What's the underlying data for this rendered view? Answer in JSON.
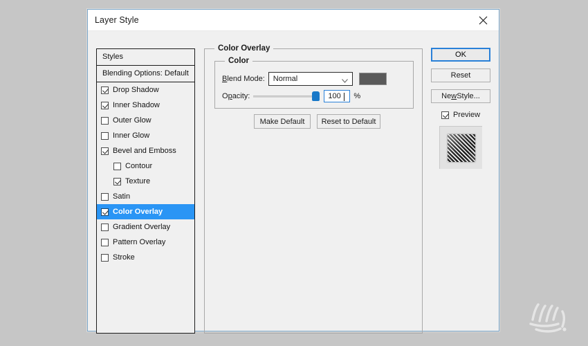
{
  "window": {
    "title": "Layer Style",
    "close_icon": "close-icon"
  },
  "styles_panel": {
    "header": "Styles",
    "blending_options": "Blending Options: Default",
    "items": [
      {
        "label": "Drop Shadow",
        "checked": true,
        "indent": false,
        "selected": false
      },
      {
        "label": "Inner Shadow",
        "checked": true,
        "indent": false,
        "selected": false
      },
      {
        "label": "Outer Glow",
        "checked": false,
        "indent": false,
        "selected": false
      },
      {
        "label": "Inner Glow",
        "checked": false,
        "indent": false,
        "selected": false
      },
      {
        "label": "Bevel and Emboss",
        "checked": true,
        "indent": false,
        "selected": false
      },
      {
        "label": "Contour",
        "checked": false,
        "indent": true,
        "selected": false
      },
      {
        "label": "Texture",
        "checked": true,
        "indent": true,
        "selected": false
      },
      {
        "label": "Satin",
        "checked": false,
        "indent": false,
        "selected": false
      },
      {
        "label": "Color Overlay",
        "checked": true,
        "indent": false,
        "selected": true
      },
      {
        "label": "Gradient Overlay",
        "checked": false,
        "indent": false,
        "selected": false
      },
      {
        "label": "Pattern Overlay",
        "checked": false,
        "indent": false,
        "selected": false
      },
      {
        "label": "Stroke",
        "checked": false,
        "indent": false,
        "selected": false
      }
    ]
  },
  "content": {
    "group_title": "Color Overlay",
    "subgroup_title": "Color",
    "blend_mode": {
      "label": "Blend Mode:",
      "label_accel": "B",
      "label_rest": "lend Mode:",
      "value": "Normal",
      "arrow_icon": "chevron-down-icon",
      "swatch_color": "#5a5a5a"
    },
    "opacity": {
      "label": "Opacity:",
      "label_pre": "O",
      "label_accel": "p",
      "label_post": "acity:",
      "value": "100",
      "unit": "%",
      "slider_percent": 100,
      "thumb_color": "#1878c8"
    },
    "make_default": "Make Default",
    "reset_to_default": "Reset to Default"
  },
  "right_panel": {
    "ok": "OK",
    "reset": "Reset",
    "new_style_pre": "Ne",
    "new_style_accel": "w",
    "new_style_post": " Style...",
    "preview_label": "Preview",
    "preview_checked": true,
    "focus_color": "#2980d8"
  },
  "theme": {
    "desktop_background": "#c6c6c6",
    "dialog_background": "#f0f0f0",
    "dialog_border": "#7aa5c8",
    "selection_blue": "#2a95f5"
  }
}
